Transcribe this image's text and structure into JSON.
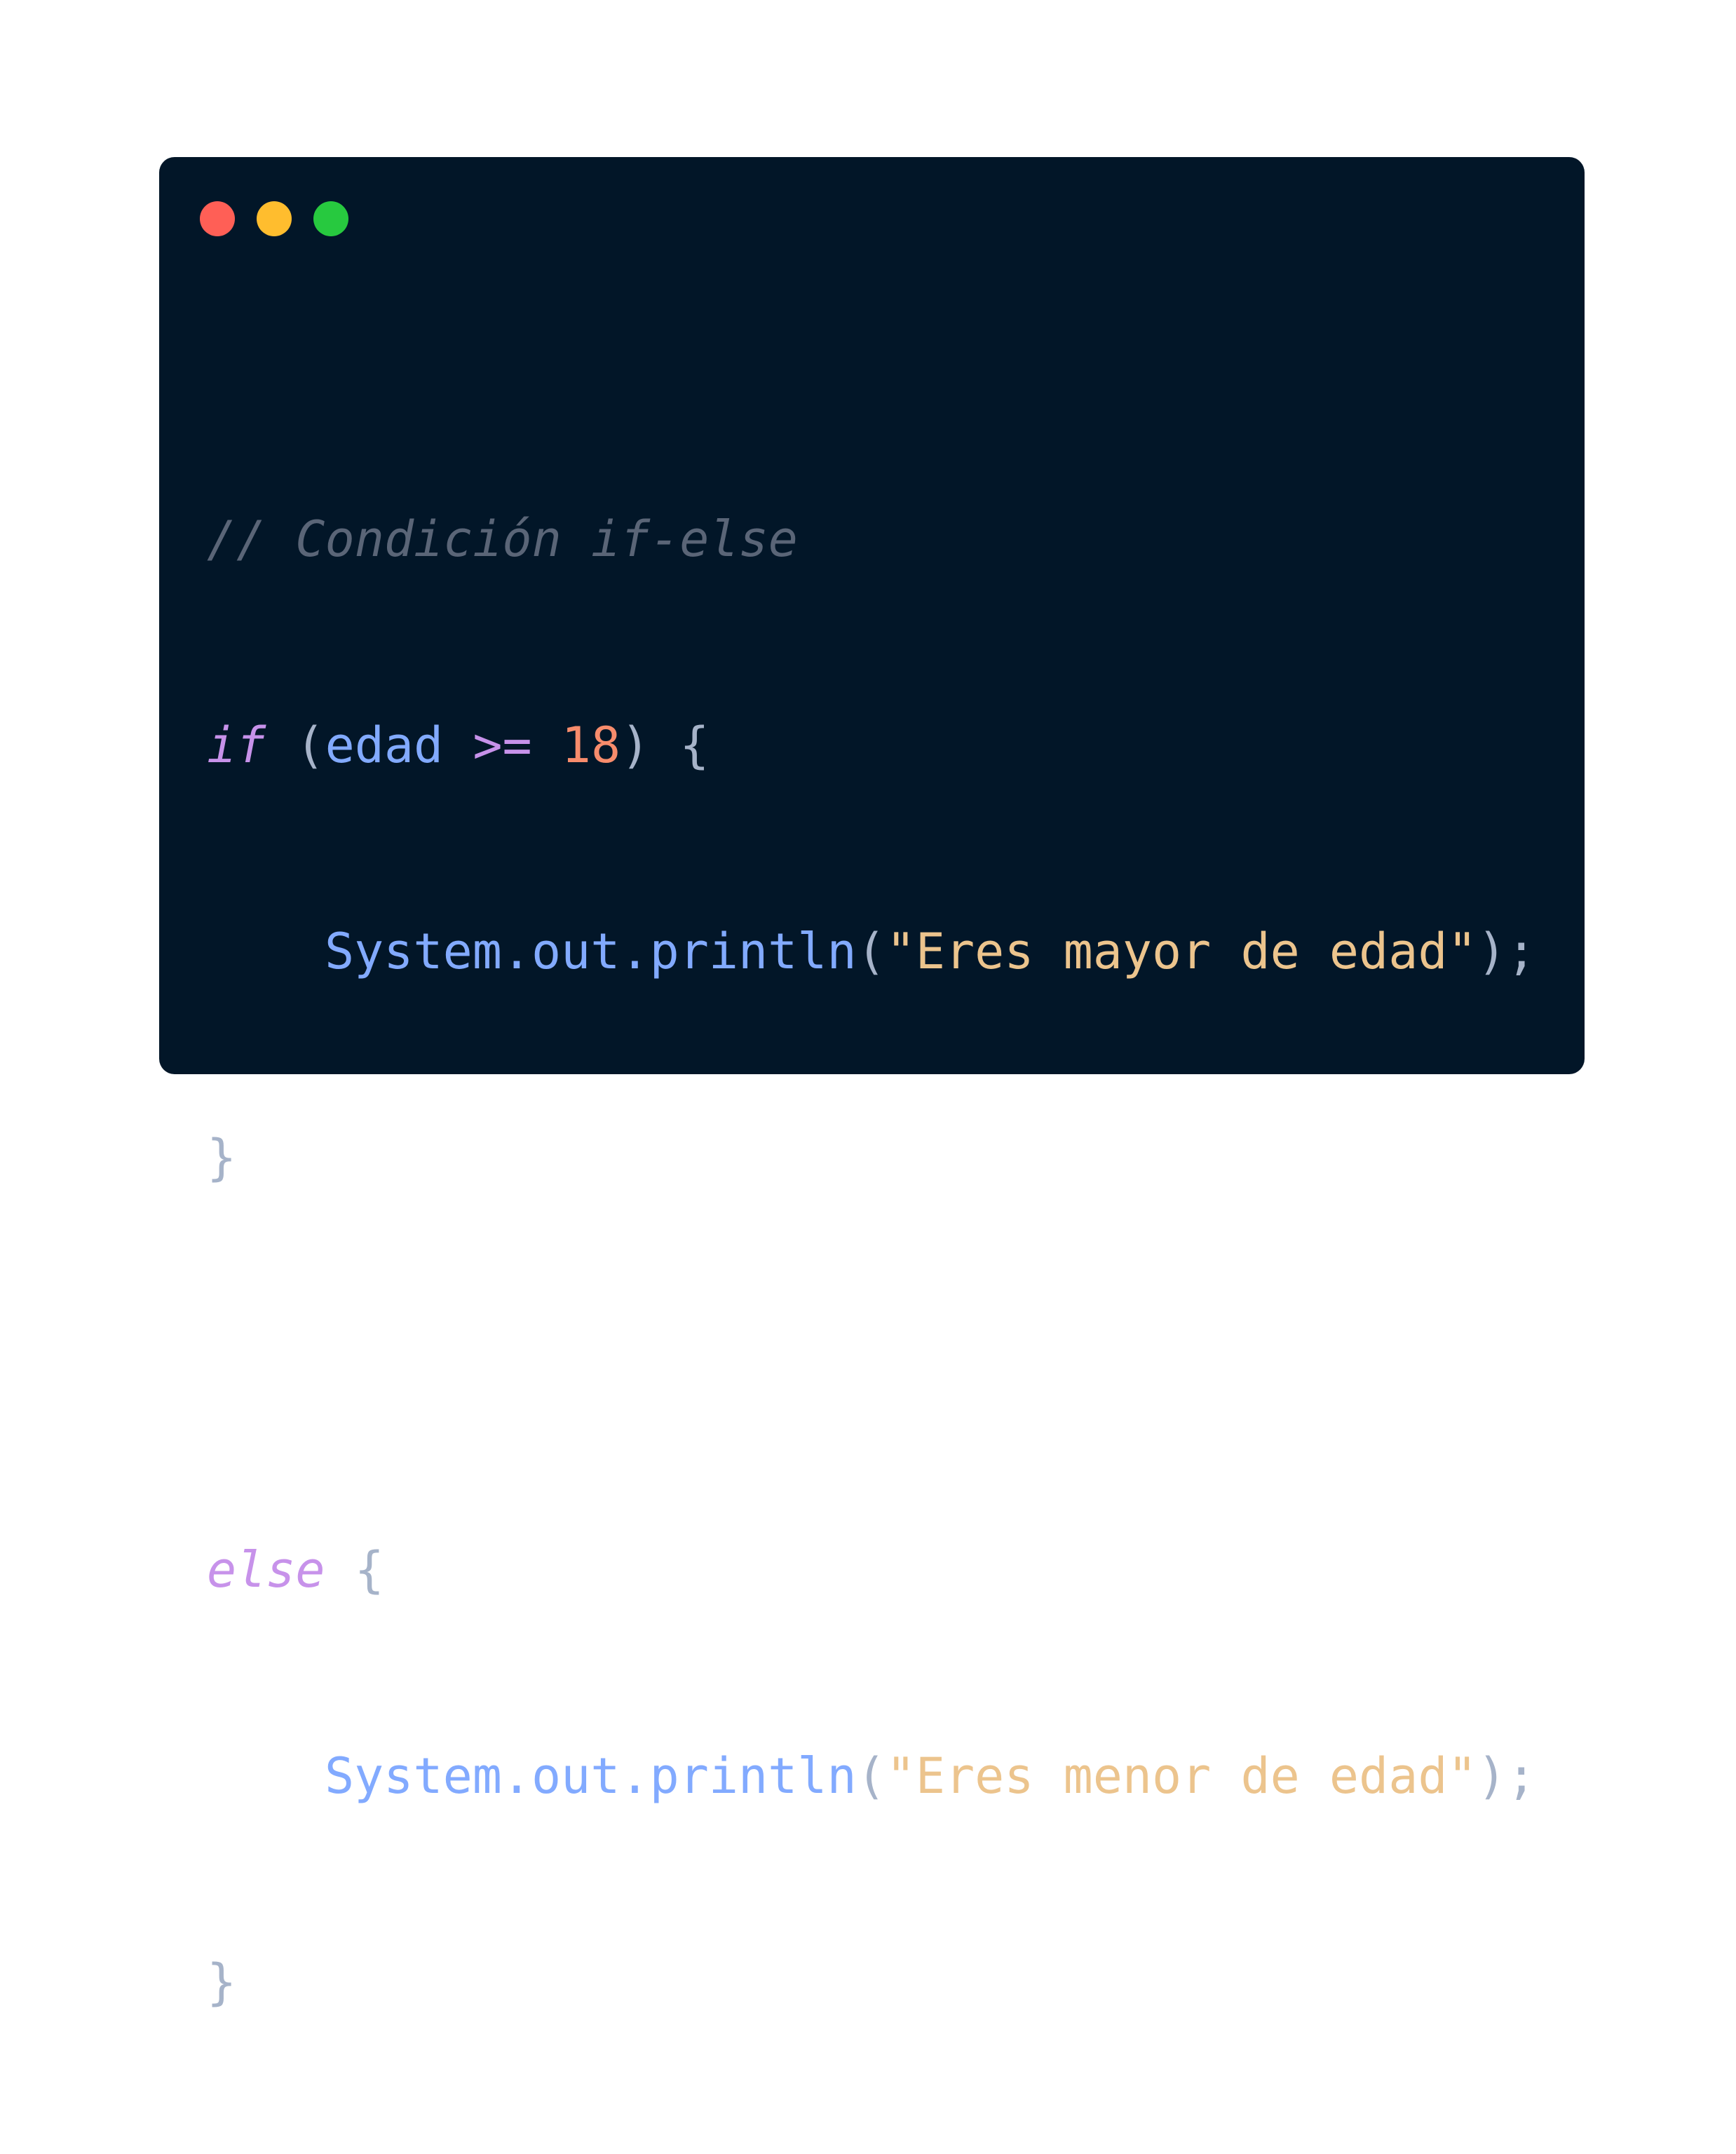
{
  "window": {
    "traffic_lights": [
      {
        "name": "close",
        "color": "#ff5f56"
      },
      {
        "name": "minimize",
        "color": "#ffbd2e"
      },
      {
        "name": "maximize",
        "color": "#27c93f"
      }
    ]
  },
  "code": {
    "comment": "// Condición if-else",
    "if_keyword": "if",
    "open_paren": "(",
    "var_name": "edad",
    "operator": ">=",
    "number": "18",
    "close_paren_brace": ") {",
    "line2_ident": "System.out.println",
    "line2_open": "(",
    "line2_string": "\"Eres mayor de edad\"",
    "line2_close": ");",
    "close_brace_1": "}",
    "else_keyword": "else",
    "else_brace": "{",
    "line5_ident": "System.out.println",
    "line5_open": "(",
    "line5_string": "\"Eres menor de edad\"",
    "line5_close": ");",
    "close_brace_2": "}"
  }
}
